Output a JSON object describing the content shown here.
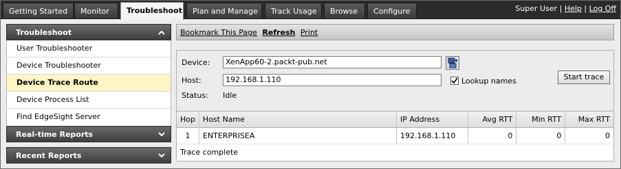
{
  "nav": {
    "tabs": [
      {
        "label": "Getting Started"
      },
      {
        "label": "Monitor"
      },
      {
        "label": "Troubleshoot",
        "active": true
      },
      {
        "label": "Plan and Manage"
      },
      {
        "label": "Track Usage"
      },
      {
        "label": "Browse"
      },
      {
        "label": "Configure"
      }
    ],
    "user": "Super User",
    "separator": "|",
    "help": "Help",
    "logoff": "Log Off"
  },
  "sidebar": {
    "sections": [
      {
        "title": "Troubleshoot",
        "expanded": true,
        "items": [
          {
            "label": "User Troubleshooter"
          },
          {
            "label": "Device Troubleshooter"
          },
          {
            "label": "Device Trace Route",
            "active": true
          },
          {
            "label": "Device Process List"
          },
          {
            "label": "Find EdgeSight Server"
          }
        ]
      },
      {
        "title": "Real-time Reports",
        "expanded": false
      },
      {
        "title": "Recent Reports",
        "expanded": false
      }
    ]
  },
  "toolbar": {
    "bookmark": "Bookmark This Page",
    "refresh": "Refresh",
    "print": "Print"
  },
  "form": {
    "device_label": "Device:",
    "device_value": "XenApp60-2.packt-pub.net",
    "host_label": "Host:",
    "host_value": "192.168.1.110",
    "status_label": "Status:",
    "status_value": "Idle",
    "lookup_label": "Lookup names",
    "lookup_checked": true,
    "start_button": "Start trace",
    "picker_icon": "device-picker-icon"
  },
  "table": {
    "headers": [
      "Hop",
      "Host Name",
      "IP Address",
      "Avg RTT",
      "Min RTT",
      "Max RTT"
    ],
    "rows": [
      [
        "1",
        "ENTERPRISEA",
        "192.168.1.110",
        "0",
        "0",
        "0"
      ]
    ],
    "footer": "Trace complete"
  },
  "colors": {
    "nav_background": "#2b2b2b",
    "active_item": "#fdf5c6",
    "panel_background": "#ececec"
  }
}
